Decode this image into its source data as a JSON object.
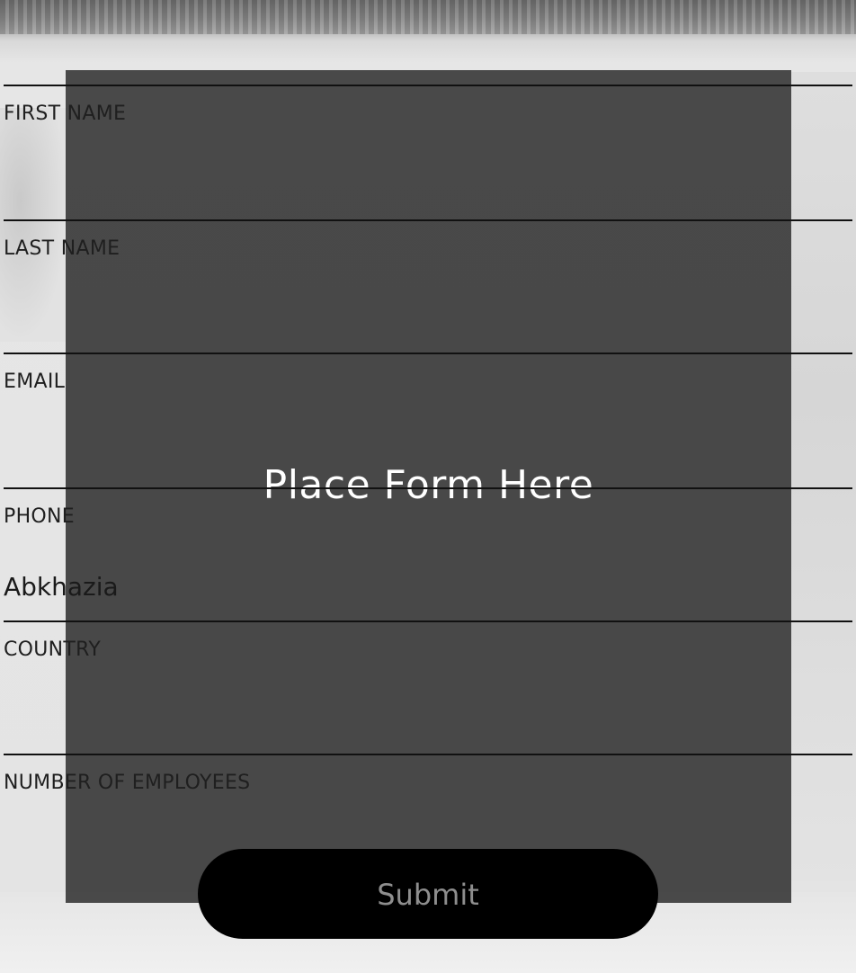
{
  "placeholder": {
    "text": "Place Form Here"
  },
  "form": {
    "fields": [
      {
        "label": "FIRST NAME",
        "value": "",
        "placeholder": ""
      },
      {
        "label": "LAST NAME",
        "value": "",
        "placeholder": ""
      },
      {
        "label": "EMAIL",
        "value": "",
        "placeholder": ""
      },
      {
        "label": "PHONE",
        "value": "",
        "placeholder": "Abkhazia"
      },
      {
        "label": "COUNTRY",
        "value": "",
        "placeholder": ""
      },
      {
        "label": "NUMBER OF EMPLOYEES",
        "value": "",
        "placeholder": ""
      }
    ],
    "submit_label": "Submit"
  }
}
